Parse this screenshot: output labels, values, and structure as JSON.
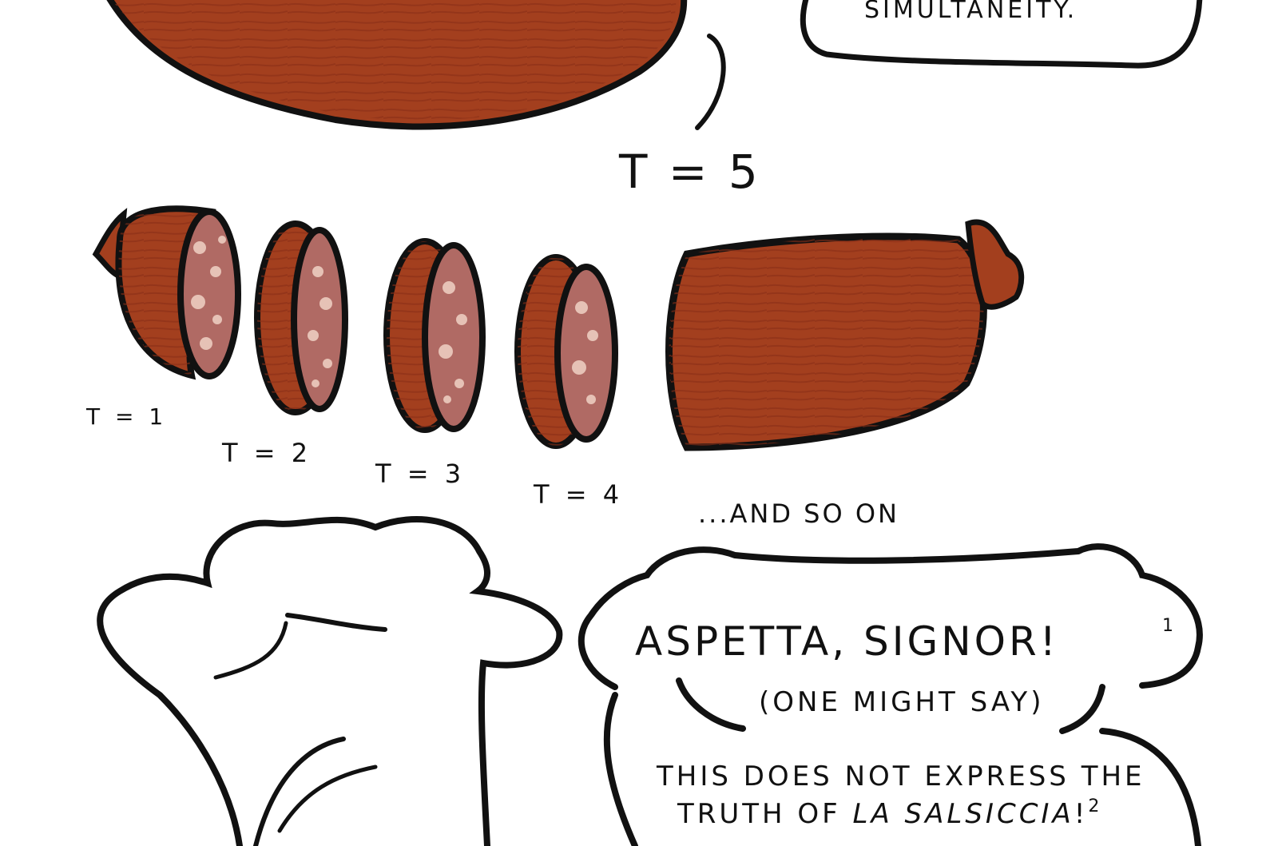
{
  "top_bubble_text": "SIMULTANEITY.",
  "big_label": "T = 5",
  "slice_labels": [
    "T = 1",
    "T = 2",
    "T = 3",
    "T = 4"
  ],
  "and_so_on": "...AND SO ON",
  "bubble": {
    "exclaim": "ASPETTA, SIGNOR!",
    "exclaim_note": "1",
    "aside": "(ONE MIGHT SAY)",
    "line1": "THIS DOES NOT EXPRESS THE",
    "line2_plain": "TRUTH OF ",
    "line2_italic": "LA SALSICCIA",
    "line2_end": "!",
    "line2_note": "2"
  },
  "colors": {
    "sausage": "#a33f1e",
    "sausage_grain": "#8a2f17",
    "slice_face": "#b06a64",
    "fat_spot": "#e6c2b6",
    "ink": "#111111"
  }
}
